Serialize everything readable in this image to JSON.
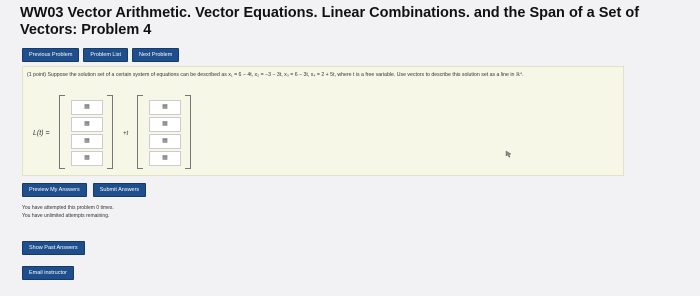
{
  "page": {
    "title": "WW03 Vector Arithmetic. Vector Equations. Linear Combinations. and the Span of a Set of Vectors: Problem 4"
  },
  "nav": {
    "previous": "Previous Problem",
    "list": "Problem List",
    "next": "Next Problem"
  },
  "problem": {
    "text": "(1 point) Suppose the solution set of a certain system of equations can be described as x₁ = 6 − 4t, x₂ = −3 − 3t, x₃ = 6 − 3t, x₄ = 2 + 5t, where t is a free variable. Use vectors to describe this solution set as a line in ℝ⁴.",
    "lhs": "L(t) =",
    "plus_t": "+t",
    "cell_placeholder": "▦"
  },
  "answers": {
    "preview": "Preview My Answers",
    "submit": "Submit Answers"
  },
  "status": {
    "attempted": "You have attempted this problem 0 times.",
    "remaining": "You have unlimited attempts remaining."
  },
  "links": {
    "show_past": "Show Past Answers",
    "email": "Email instructor"
  }
}
